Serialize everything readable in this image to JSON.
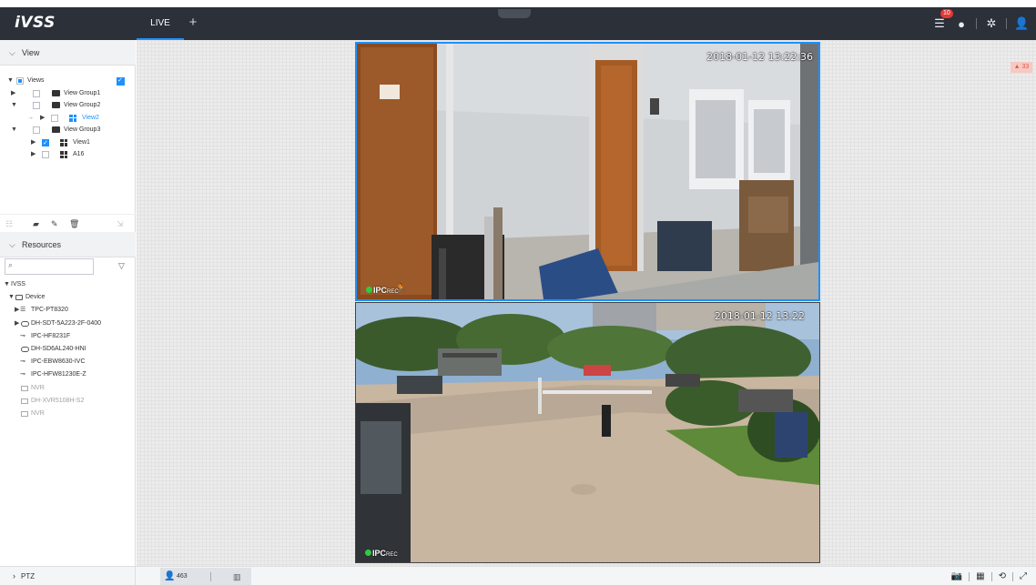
{
  "app": {
    "logo": "iVSS",
    "tabs": [
      {
        "label": "LIVE"
      }
    ],
    "add_tab": "+",
    "alarm_badge": "10"
  },
  "left_panel": {
    "view_section": {
      "title": "View"
    },
    "view_tree": [
      {
        "label": "Views"
      },
      {
        "label": "View Group1"
      },
      {
        "label": "View Group2"
      },
      {
        "label": "View2"
      },
      {
        "label": "View Group3"
      },
      {
        "label": "View1"
      },
      {
        "label": "A16"
      }
    ],
    "resources_section": {
      "title": "Resources"
    },
    "search": {
      "value": "",
      "placeholder": ""
    },
    "resource_tree": [
      {
        "label": "IVSS"
      },
      {
        "label": "Device"
      },
      {
        "label": "TPC-PT8320"
      },
      {
        "label": "DH-SDT-5A223-2F-0400"
      },
      {
        "label": "IPC-HF8231F"
      },
      {
        "label": "DH-SD6AL240-HNI"
      },
      {
        "label": "IPC-EBW8630-IVC"
      },
      {
        "label": "IPC-HFW81230E-Z"
      },
      {
        "label": "NVR"
      },
      {
        "label": "DH-XVR5108H-S2"
      },
      {
        "label": "NVR"
      }
    ]
  },
  "center": {
    "alarm_chip": "33",
    "videos": [
      {
        "timestamp": "2018-01-12 13:22:36",
        "osd": "IPC",
        "rec": "REC"
      },
      {
        "timestamp": "2018-01-12 13:22",
        "osd": "IPC",
        "rec": "REC"
      }
    ]
  },
  "bottom": {
    "ptz_label": "PTZ",
    "people_count": "463"
  },
  "icons": {
    "alarm": "list-alarm-icon",
    "settings": "gear-icon",
    "user": "user-icon",
    "snapshot": "camera-icon",
    "split": "split-screen-icon",
    "playback": "playback-icon",
    "fullscreen": "fullscreen-icon"
  },
  "colors": {
    "topbar": "#2b3039",
    "accent": "#1e90ff",
    "badge": "#e53935",
    "alarm_chip": "#f7c9c3"
  }
}
